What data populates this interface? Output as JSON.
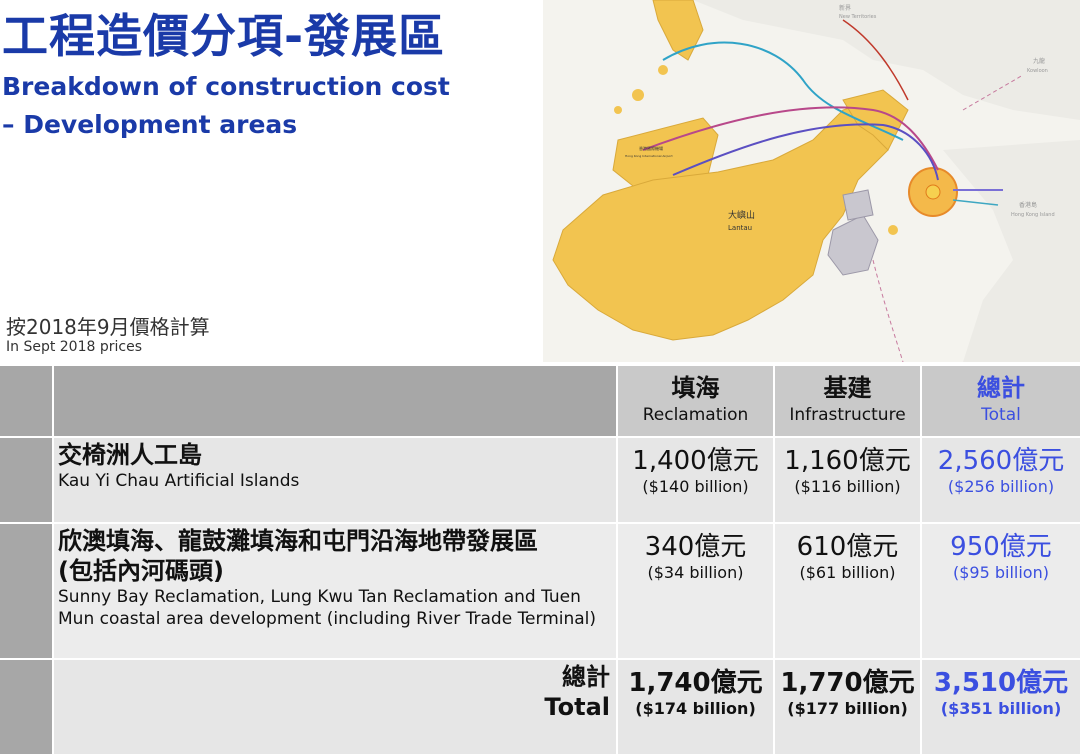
{
  "header": {
    "title_zh": "工程造價分項-發展區",
    "title_en_line1": "Breakdown of construction cost",
    "title_en_line2": "– Development areas",
    "price_note_zh": "按2018年9月價格計算",
    "price_note_en": "In Sept 2018 prices"
  },
  "map": {
    "label_lantau_zh": "大嶼山",
    "label_lantau_en": "Lantau",
    "label_nt_zh": "新界",
    "label_nt_en": "New Territories",
    "label_kowloon_zh": "九龍",
    "label_kowloon_en": "Kowloon",
    "label_hki_zh": "香港島",
    "label_hki_en": "Hong Kong Island",
    "label_airport_zh": "香港國際機場",
    "label_airport_en": "Hong Kong International Airport"
  },
  "table": {
    "columns": [
      {
        "zh": "填海",
        "en": "Reclamation"
      },
      {
        "zh": "基建",
        "en": "Infrastructure"
      },
      {
        "zh": "總計",
        "en": "Total"
      }
    ],
    "rows": [
      {
        "name_zh": "交椅洲人工島",
        "name_en": "Kau Yi Chau Artificial Islands",
        "reclamation": "1,400億元",
        "reclamation_sub": "($140 billion)",
        "infrastructure": "1,160億元",
        "infrastructure_sub": "($116 billion)",
        "total": "2,560億元",
        "total_sub": "($256 billion)"
      },
      {
        "name_zh_line1": "欣澳填海、龍鼓灘填海和屯門沿海地帶發展區",
        "name_zh_line2": "(包括內河碼頭)",
        "name_en_line1": "Sunny Bay Reclamation, Lung Kwu Tan Reclamation and Tuen",
        "name_en_line2": "Mun coastal area development (including River Trade Terminal)",
        "reclamation": "340億元",
        "reclamation_sub": "($34 billion)",
        "infrastructure": "610億元",
        "infrastructure_sub": "($61 billion)",
        "total": "950億元",
        "total_sub": "($95 billion)"
      }
    ],
    "total_row": {
      "label_zh": "總計",
      "label_en": "Total",
      "reclamation": "1,740億元",
      "reclamation_sub": "($174 billion)",
      "infrastructure": "1,770億元",
      "infrastructure_sub": "($177 billion)",
      "total": "3,510億元",
      "total_sub": "($351 billion)"
    }
  },
  "colors": {
    "title_blue": "#1a3aa8",
    "total_blue": "#3b4fe0",
    "land_yellow": "#f2c450"
  }
}
